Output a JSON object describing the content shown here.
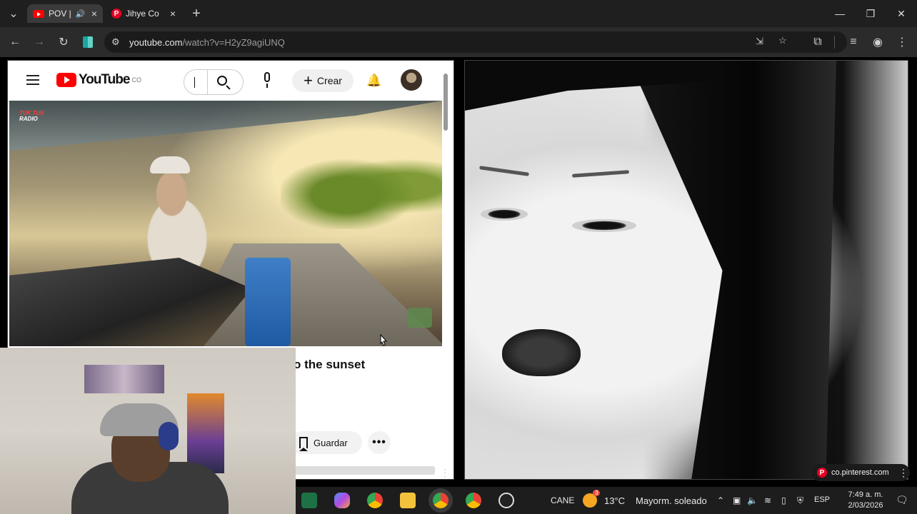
{
  "browser": {
    "tabs": [
      {
        "title": "POV |",
        "favicon": "youtube-icon",
        "audio": true,
        "close": "×"
      },
      {
        "title": "Jihye Co",
        "favicon": "pinterest-icon",
        "close": "×"
      }
    ],
    "new_tab": "+",
    "window_controls": {
      "minimize": "—",
      "restore": "❐",
      "close": "✕"
    },
    "nav": {
      "back": "←",
      "forward": "→",
      "reload": "↻"
    },
    "url": {
      "host": "youtube.com",
      "path": "/watch?v=H2yZ9agiUNQ"
    }
  },
  "youtube": {
    "logo_text": "YouTube",
    "logo_country": "CO",
    "search_placeholder": "",
    "create_label": "Crear",
    "video": {
      "overlay_logo_line1": "TUK TUK",
      "overlay_logo_line2": "RADIO",
      "title_visible": "o the sunset"
    },
    "actions": {
      "save_label": "Guardar",
      "more_label": "•••"
    }
  },
  "pinterest": {
    "badge_text": "co.pinterest.com",
    "badge_icon": "pinterest-icon",
    "more": "⋮"
  },
  "taskbar": {
    "weather_badge": "3",
    "language_widget": "CANE",
    "temperature": "13°C",
    "weather_desc": "Mayorm. soleado",
    "input_lang": "ESP",
    "time": "7:49 a. m.",
    "date": "2/03/2026",
    "more": "⋮"
  },
  "colors": {
    "youtube_red": "#ff0000",
    "pinterest_red": "#e60023",
    "chrome_dark": "#1f1f1f",
    "toolbar_dark": "#2b2b2b"
  }
}
